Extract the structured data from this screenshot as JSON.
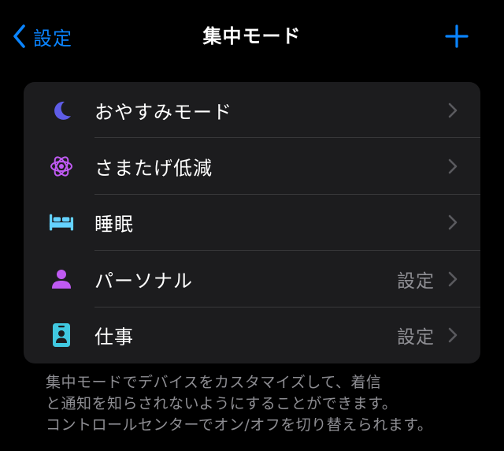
{
  "nav": {
    "back_label": "設定",
    "title": "集中モード",
    "add_icon": "plus-icon",
    "back_icon": "chevron-left-icon"
  },
  "modes": [
    {
      "label": "おやすみモード",
      "value": "",
      "icon": "moon-icon",
      "color": "#5e5ce6"
    },
    {
      "label": "さまたげ低減",
      "value": "",
      "icon": "reduce-interruptions-icon",
      "color": "#bf5af2"
    },
    {
      "label": "睡眠",
      "value": "",
      "icon": "bed-icon",
      "color": "#64d2ff"
    },
    {
      "label": "パーソナル",
      "value": "設定",
      "icon": "person-icon",
      "color": "#bf5af2"
    },
    {
      "label": "仕事",
      "value": "設定",
      "icon": "id-badge-icon",
      "color": "#40c8e0"
    }
  ],
  "footer": {
    "line1": "集中モードでデバイスをカスタマイズして、着信",
    "line2": "と通知を知らされないようにすることができます。",
    "line3": "コントロールセンターでオン/オフを切り替えられます。"
  },
  "colors": {
    "accent": "#0a84ff",
    "background": "#000000",
    "card": "#1c1c1e",
    "secondary_text": "#8e8e93"
  }
}
